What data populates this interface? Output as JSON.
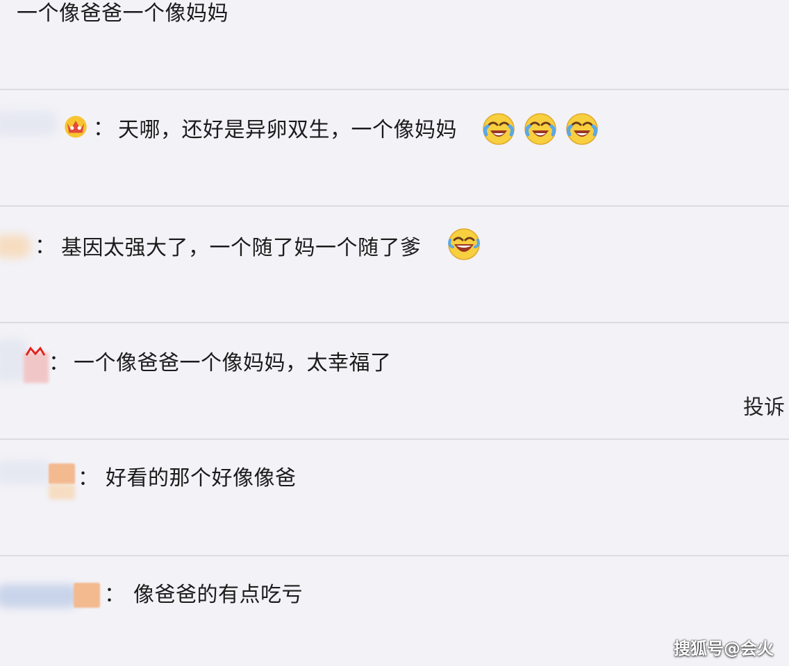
{
  "comments": [
    {
      "text": "一个像爸爸一个像妈妈"
    },
    {
      "colon": "：",
      "text": "天哪，还好是异卵双生，一个像妈妈",
      "emojis": [
        "laugh-cry-emoji",
        "laugh-cry-emoji",
        "laugh-cry-emoji"
      ],
      "badge": "crown-icon"
    },
    {
      "colon": "：",
      "text": "基因太强大了，一个随了妈一个随了爹",
      "emojis": [
        "laugh-emoji"
      ]
    },
    {
      "colon": "：",
      "text": "一个像爸爸一个像妈妈，太幸福了",
      "action": "投诉"
    },
    {
      "colon": "：",
      "text": "好看的那个好像像爸"
    },
    {
      "colon": "：",
      "text": "像爸爸的有点吃亏"
    }
  ],
  "watermark": "搜狐号@会火",
  "colors": {
    "background": "#f3f2f7",
    "divider": "#dcdbe1",
    "text": "#1b1b1b"
  }
}
